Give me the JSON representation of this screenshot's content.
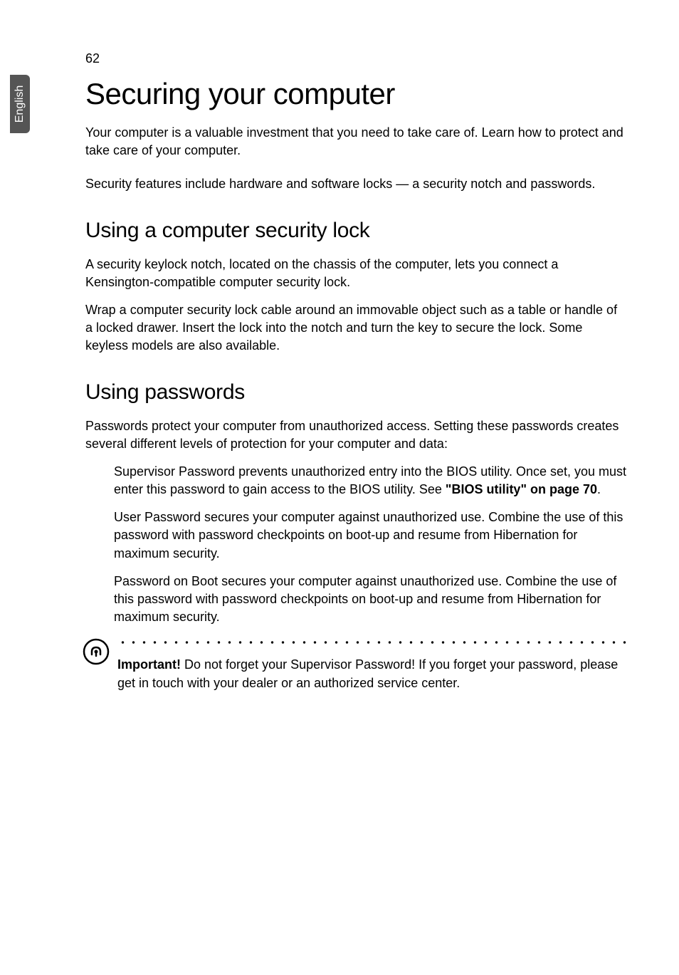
{
  "page_number": "62",
  "side_tab": "English",
  "heading1": "Securing your computer",
  "intro_p1": "Your computer is a valuable investment that you need to take care of. Learn how to protect and take care of your computer.",
  "intro_p2": "Security features include hardware and software locks — a security notch and passwords.",
  "section1": {
    "heading": "Using a computer security lock",
    "p1": "A security keylock notch, located on the chassis of the computer, lets you connect a Kensington-compatible computer security lock.",
    "p2": "Wrap a computer security lock cable around an immovable object such as a table or handle of a locked drawer. Insert the lock into the notch and turn the key to secure the lock. Some keyless models are also available."
  },
  "section2": {
    "heading": "Using passwords",
    "p1": "Passwords protect your computer from unauthorized access. Setting these passwords creates several different levels of protection for your computer and data:",
    "item1_a": "Supervisor Password prevents unauthorized entry into the BIOS utility. Once set, you must enter this password to gain access to the BIOS utility. See ",
    "item1_bold": "\"BIOS utility\" on page 70",
    "item1_b": ".",
    "item2": "User Password secures your computer against unauthorized use. Combine the use of this password with password checkpoints on boot-up and resume from Hibernation for maximum security.",
    "item3": "Password on Boot secures your computer against unauthorized use. Combine the use of this password with password checkpoints on boot-up and resume from Hibernation for maximum security.",
    "note_bold": "Important!",
    "note_text": " Do not forget your Supervisor Password! If you forget your password, please get in touch with your dealer or an authorized service center."
  }
}
